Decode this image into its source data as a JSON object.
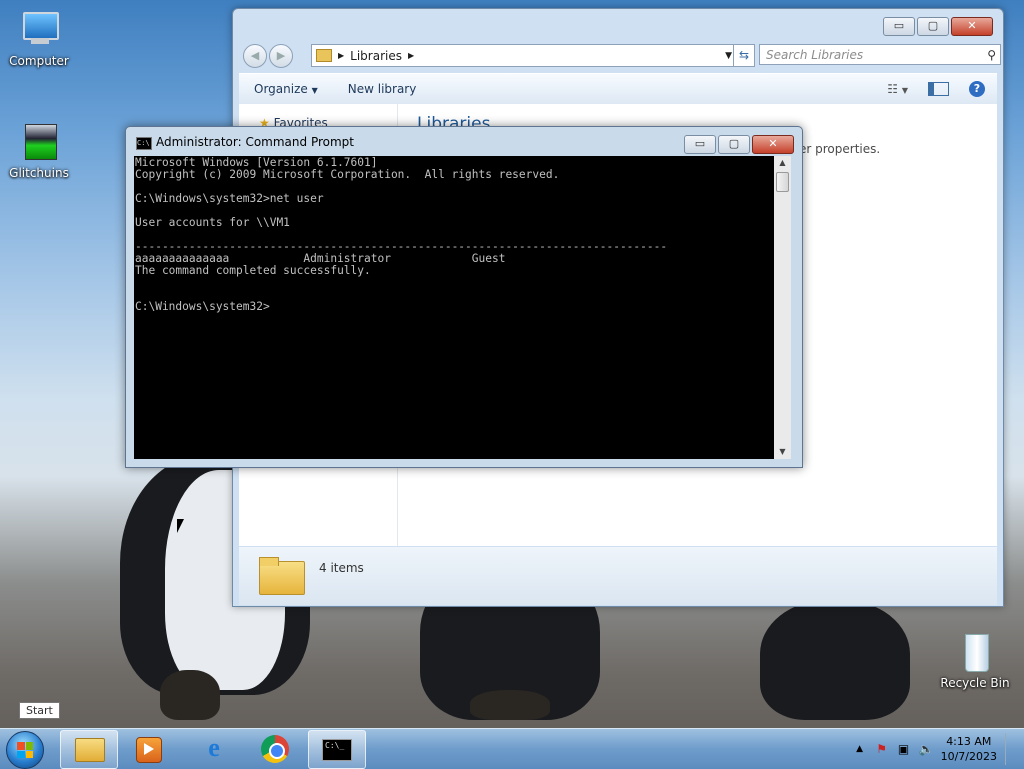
{
  "desktop": {
    "icons": [
      {
        "label": "Computer",
        "icon": "computer-icon"
      },
      {
        "label": "Glitchuins",
        "icon": "glitchuins-icon"
      },
      {
        "label": "Recycle Bin",
        "icon": "recycle-bin-icon"
      }
    ]
  },
  "explorer": {
    "address_crumb": "Libraries",
    "search_placeholder": "Search Libraries",
    "toolbar": {
      "organize": "Organize",
      "new_library": "New library"
    },
    "nav": {
      "favorites": "Favorites"
    },
    "heading": "Libraries",
    "subtitle": "er properties.",
    "details": {
      "items": "4 items"
    },
    "buttons": {
      "minimize": "▭",
      "maximize": "▢",
      "close": "✕"
    }
  },
  "cmd": {
    "title": "Administrator:  Command Prompt",
    "lines": [
      "Microsoft Windows [Version 6.1.7601]",
      "Copyright (c) 2009 Microsoft Corporation.  All rights reserved.",
      "",
      "C:\\Windows\\system32>net user",
      "",
      "User accounts for \\\\VM1",
      "",
      "-------------------------------------------------------------------------------",
      "aaaaaaaaaaaaaa           Administrator            Guest",
      "The command completed successfully.",
      "",
      "",
      "C:\\Windows\\system32>"
    ]
  },
  "tooltip": "Start",
  "taskbar": {
    "pinned": [
      "windows-explorer-icon",
      "media-player-icon",
      "internet-explorer-icon",
      "chrome-icon",
      "command-prompt-icon"
    ],
    "clock_time": "4:13 AM",
    "clock_date": "10/7/2023"
  }
}
